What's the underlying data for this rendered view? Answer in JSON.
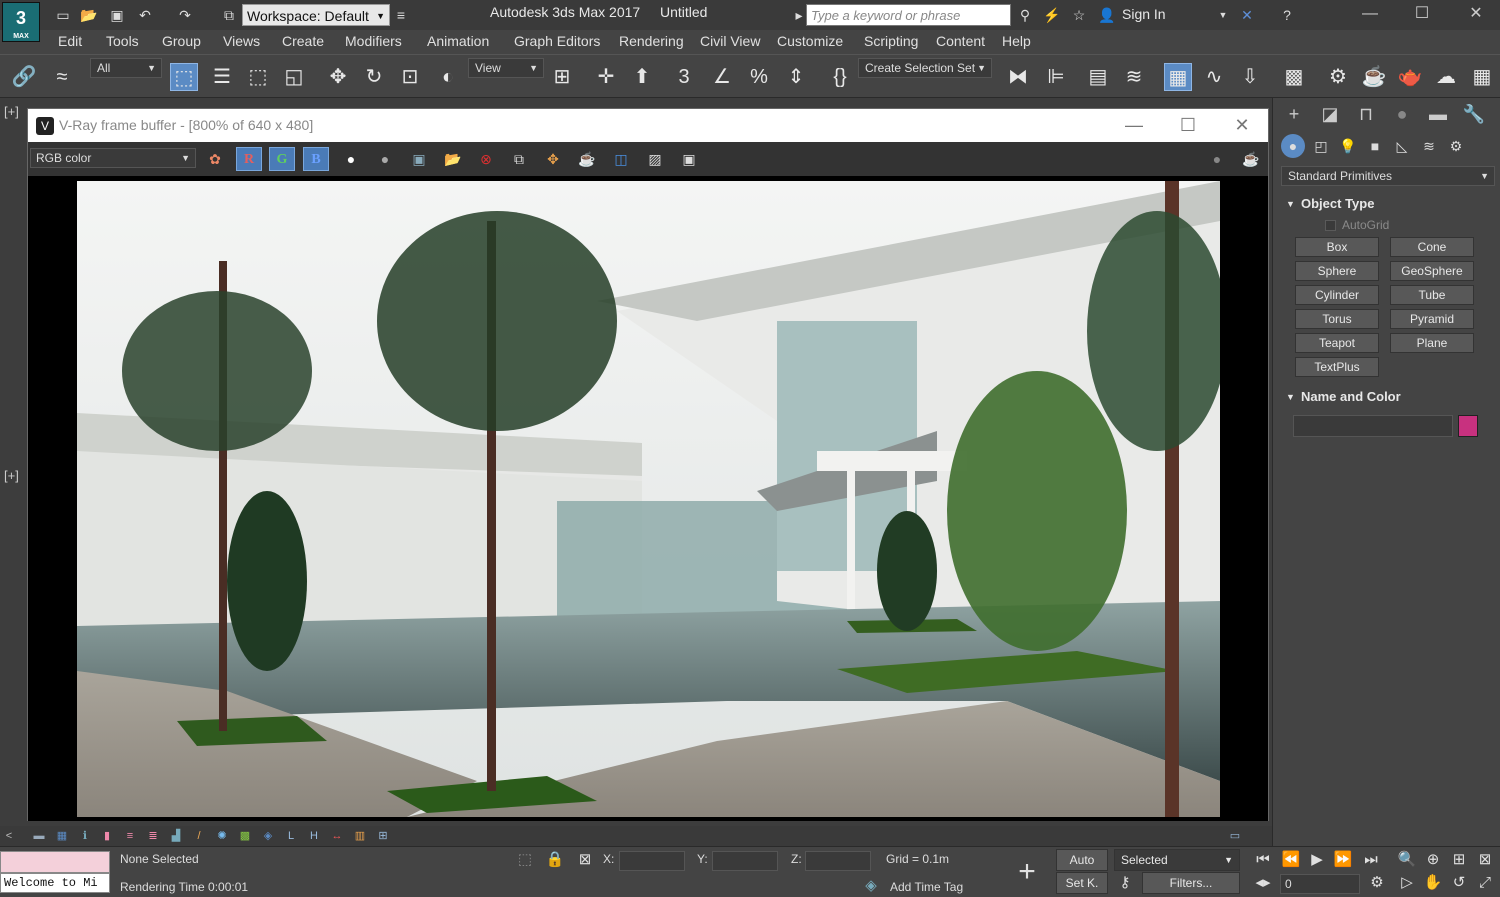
{
  "titlebar": {
    "logo_text": "3",
    "logo_sub": "MAX",
    "workspace": "Workspace: Default",
    "app_title": "Autodesk 3ds Max 2017",
    "doc_title": "Untitled",
    "search_placeholder": "Type a keyword or phrase",
    "signin": "Sign In"
  },
  "menu": [
    "Edit",
    "Tools",
    "Group",
    "Views",
    "Create",
    "Modifiers",
    "Animation",
    "Graph Editors",
    "Rendering",
    "Civil View",
    "Customize",
    "Scripting",
    "Content",
    "Help"
  ],
  "toolbar": {
    "filter_value": "All",
    "refcoord_value": "View",
    "selection_set_value": "Create Selection Set"
  },
  "viewport": {
    "label_top": "[+]",
    "label_bottom": "[+]"
  },
  "vfb": {
    "title": "V-Ray frame buffer - [800% of 640 x 480]",
    "channel": "RGB color",
    "btn_r": "R",
    "btn_g": "G",
    "btn_b": "B"
  },
  "command_panel": {
    "category": "Standard Primitives",
    "object_type_title": "Object Type",
    "autogrid": "AutoGrid",
    "primitives": [
      "Box",
      "Cone",
      "Sphere",
      "GeoSphere",
      "Cylinder",
      "Tube",
      "Torus",
      "Pyramid",
      "Teapot",
      "Plane",
      "TextPlus"
    ],
    "name_color_title": "Name and Color",
    "object_color": "#c8317f"
  },
  "status": {
    "listener_text": "Welcome to Mi",
    "selection": "None Selected",
    "render_time": "Rendering Time  0:00:01",
    "x_label": "X:",
    "y_label": "Y:",
    "z_label": "Z:",
    "grid": "Grid = 0.1m",
    "add_time_tag": "Add Time Tag",
    "auto_key": "Auto",
    "set_key": "Set K.",
    "key_filter": "Selected",
    "filters": "Filters...",
    "frame": "0"
  }
}
